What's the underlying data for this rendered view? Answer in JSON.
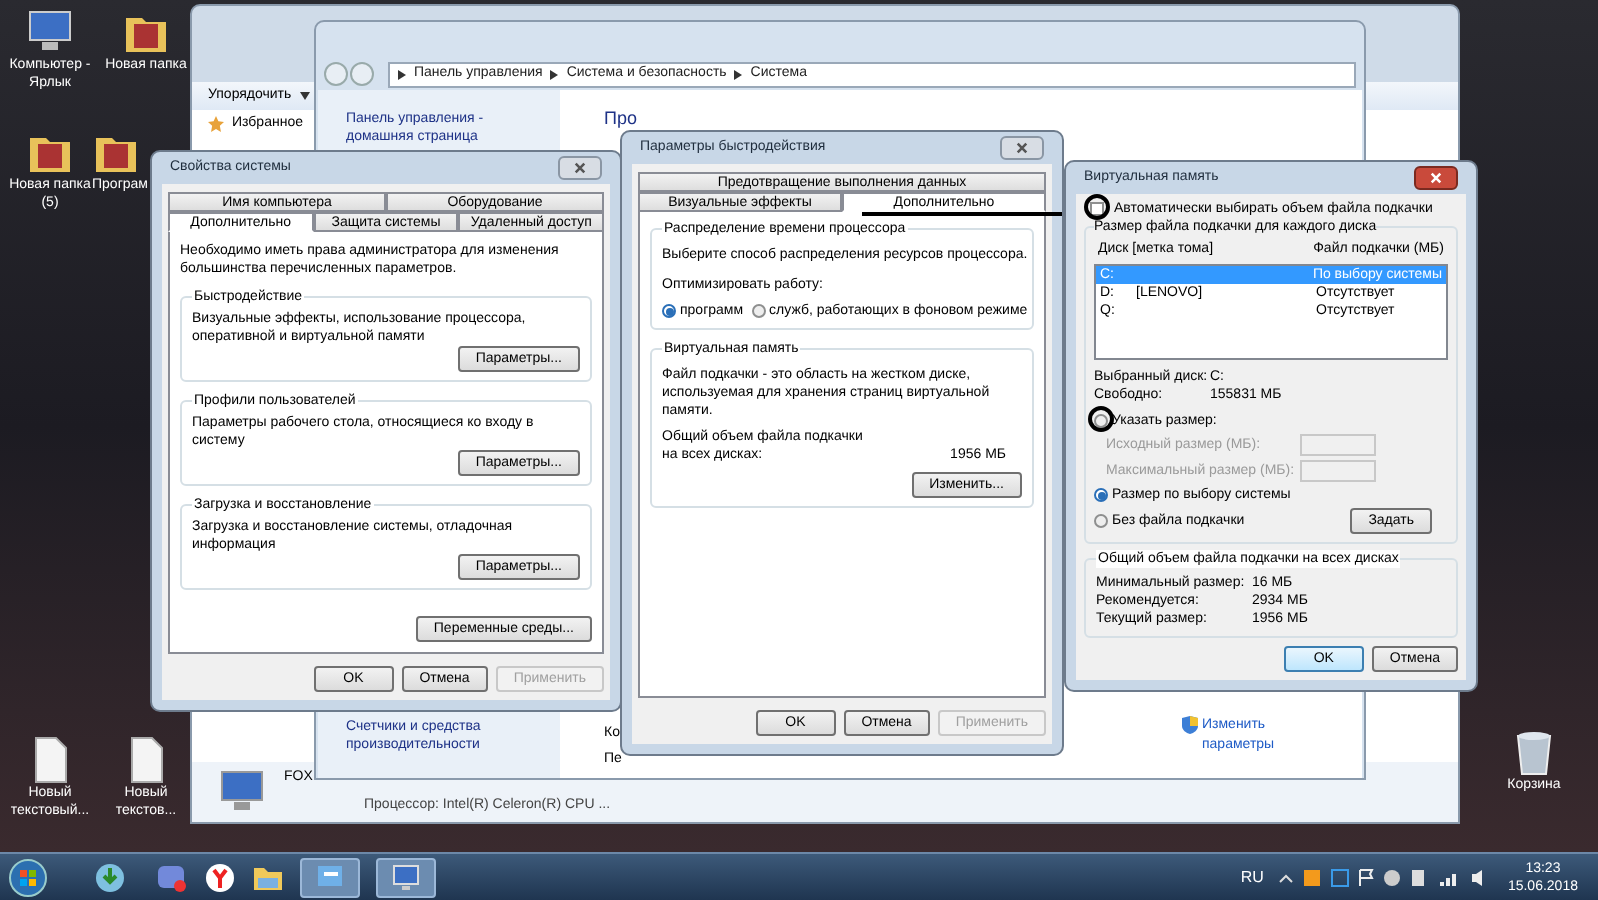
{
  "desktop_icons": [
    {
      "label": "Компьютер - Ярлык",
      "kind": "computer"
    },
    {
      "label": "Новая папка",
      "kind": "folder"
    },
    {
      "label": "Новая папка (5)",
      "kind": "folder"
    },
    {
      "label": "Програм",
      "kind": "folder"
    },
    {
      "label": "Новый текстовый...",
      "kind": "file"
    },
    {
      "label": "Новый текстов...",
      "kind": "file"
    },
    {
      "label": "Корзина",
      "kind": "recycle"
    }
  ],
  "explorer_window": {
    "organize_button": "Упорядочить",
    "nav_item": "Избранное",
    "computer_name": "FOX",
    "processor": "Процессор: Intel(R) Celeron(R) CPU ..."
  },
  "control_panel": {
    "breadcrumb": [
      "Панель управления",
      "Система и безопасность",
      "Система"
    ],
    "sidebar_links": [
      "Панель управления - домашняя страница",
      "Счетчики и средства производительности"
    ],
    "main_fragments": [
      "Про",
      "Ко",
      "Пе"
    ],
    "change_link": "Изменить параметры"
  },
  "system_properties": {
    "title": "Свойства системы",
    "tab_rows": [
      [
        {
          "label": "Имя компьютера",
          "selected": false
        },
        {
          "label": "Оборудование",
          "selected": false
        }
      ],
      [
        {
          "label": "Дополнительно",
          "selected": true
        },
        {
          "label": "Защита системы",
          "selected": false
        },
        {
          "label": "Удаленный доступ",
          "selected": false
        }
      ]
    ],
    "intro": "Необходимо иметь права администратора для изменения большинства перечисленных параметров.",
    "groups": [
      {
        "title": "Быстродействие",
        "text": "Визуальные эффекты, использование процессора, оперативной и виртуальной памяти",
        "button": "Параметры..."
      },
      {
        "title": "Профили пользователей",
        "text": "Параметры рабочего стола, относящиеся ко входу в систему",
        "button": "Параметры..."
      },
      {
        "title": "Загрузка и восстановление",
        "text": "Загрузка и восстановление системы, отладочная информация",
        "button": "Параметры..."
      }
    ],
    "env_button": "Переменные среды...",
    "buttons": [
      {
        "label": "OK",
        "disabled": false
      },
      {
        "label": "Отмена",
        "disabled": false
      },
      {
        "label": "Применить",
        "disabled": true
      }
    ]
  },
  "performance_options": {
    "title": "Параметры быстродействия",
    "tab_rows": [
      [
        {
          "label": "Предотвращение выполнения данных",
          "selected": false
        }
      ],
      [
        {
          "label": "Визуальные эффекты",
          "selected": false
        },
        {
          "label": "Дополнительно",
          "selected": true
        }
      ]
    ],
    "cpu_group": {
      "title": "Распределение времени процессора",
      "text": "Выберите способ распределения ресурсов процессора.",
      "optimize_label": "Оптимизировать работу:",
      "options": [
        {
          "label": "программ",
          "selected": true
        },
        {
          "label": "служб, работающих в фоновом режиме",
          "selected": false
        }
      ]
    },
    "vm_group": {
      "title": "Виртуальная память",
      "text": "Файл подкачки - это область на жестком диске, используемая для хранения страниц виртуальной памяти.",
      "total_label": "Общий объем файла подкачки на всех дисках:",
      "total_value": "1956 МБ",
      "button": "Изменить..."
    },
    "buttons": [
      {
        "label": "OK",
        "disabled": false
      },
      {
        "label": "Отмена",
        "disabled": false
      },
      {
        "label": "Применить",
        "disabled": true
      }
    ]
  },
  "virtual_memory": {
    "title": "Виртуальная память",
    "auto_checkbox": {
      "label": "Автоматически выбирать объем файла подкачки",
      "checked": false
    },
    "drives_group": "Размер файла подкачки для каждого диска",
    "columns": [
      "Диск [метка тома]",
      "Файл подкачки (МБ)"
    ],
    "drives": [
      {
        "drive": "C:",
        "paging": "По выбору системы",
        "selected": true
      },
      {
        "drive": "D:",
        "label": "[LENOVO]",
        "paging": "Отсутствует",
        "selected": false
      },
      {
        "drive": "Q:",
        "paging": "Отсутствует",
        "selected": false
      }
    ],
    "selected_drive_label": "Выбранный диск:",
    "selected_drive": "C:",
    "free_label": "Свободно:",
    "free_value": "155831 МБ",
    "size_options": [
      {
        "kind": "custom",
        "label": "Указать размер:",
        "selected": false
      },
      {
        "kind": "system",
        "label": "Размер по выбору системы",
        "selected": true
      },
      {
        "kind": "none",
        "label": "Без файла подкачки",
        "selected": false
      }
    ],
    "initial_size_label": "Исходный размер (МБ):",
    "max_size_label": "Максимальный размер (МБ):",
    "fields_disabled": true,
    "set_button": "Задать",
    "totals_group": "Общий объем файла подкачки на всех дисках",
    "totals": [
      {
        "label": "Минимальный размер:",
        "value": "16 МБ"
      },
      {
        "label": "Рекомендуется:",
        "value": "2934 МБ"
      },
      {
        "label": "Текущий размер:",
        "value": "1956 МБ"
      }
    ],
    "buttons": [
      {
        "label": "OK",
        "default": true
      },
      {
        "label": "Отмена",
        "default": false
      }
    ]
  },
  "tray": {
    "language": "RU",
    "time": "13:23",
    "date": "15.06.2018"
  }
}
